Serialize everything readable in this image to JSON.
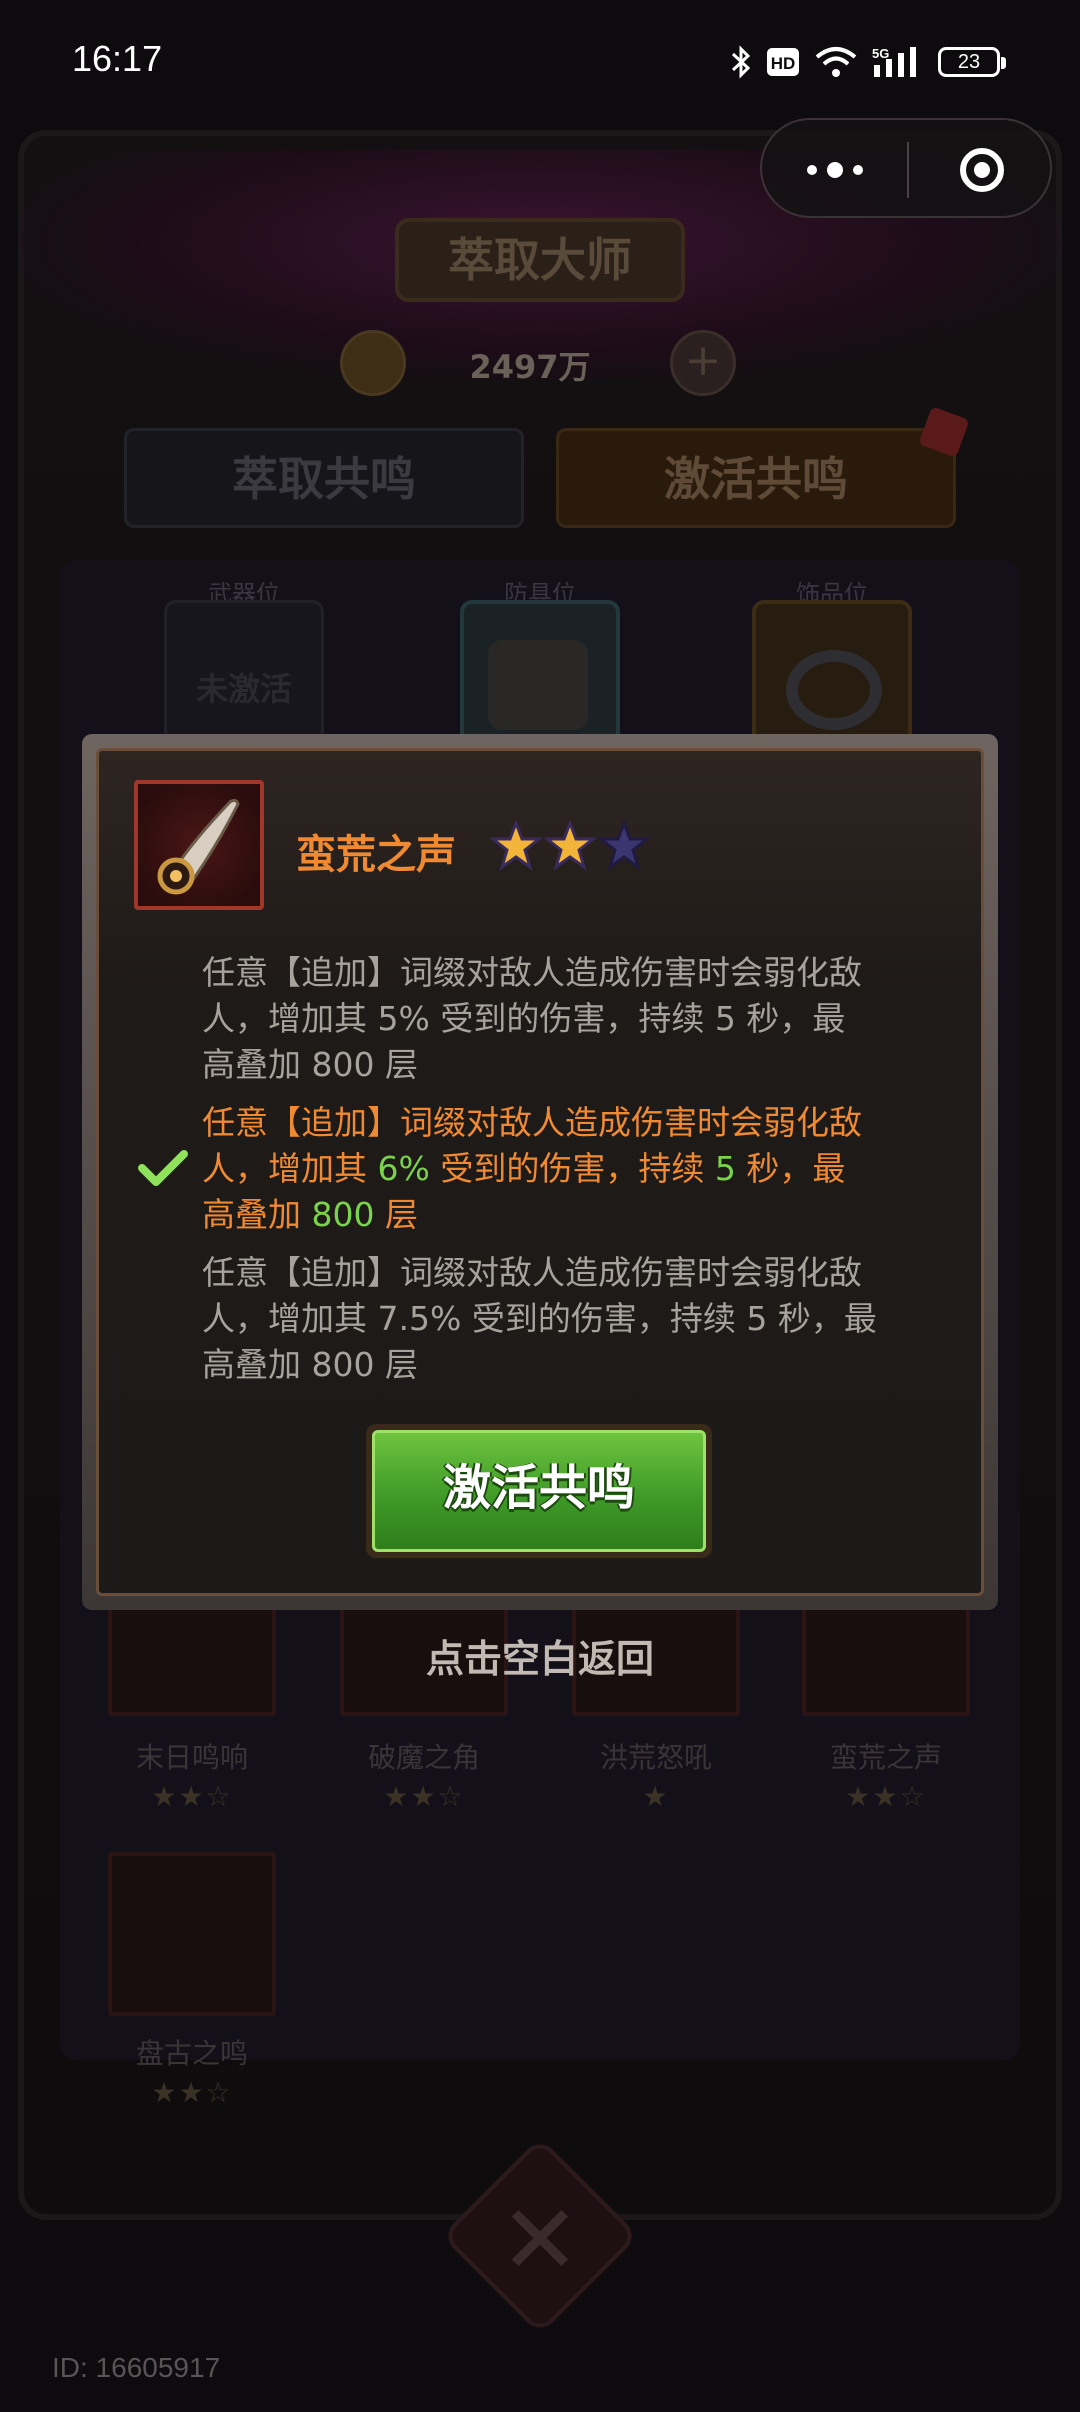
{
  "status_bar": {
    "time": "16:17",
    "battery": "23",
    "icons": [
      "bluetooth-icon",
      "hd-icon",
      "wifi-icon",
      "5g-signal-icon",
      "battery-icon"
    ]
  },
  "mini_program": {
    "more_icon": "more-dots-icon",
    "close_icon": "target-close-icon"
  },
  "background_screen": {
    "title": "萃取大师",
    "gold": "2497万",
    "tabs": [
      "萃取共鸣",
      "激活共鸣"
    ],
    "slots": [
      {
        "label": "武器位",
        "state": "未激活"
      },
      {
        "label": "防具位"
      },
      {
        "label": "饰品位"
      }
    ],
    "horns": [
      {
        "name": "末日鸣响",
        "stars": 2,
        "max_stars": 3
      },
      {
        "name": "破魔之角",
        "stars": 2,
        "max_stars": 3
      },
      {
        "name": "洪荒怒吼",
        "stars": 1,
        "max_stars": 1
      },
      {
        "name": "蛮荒之声",
        "stars": 2,
        "max_stars": 3
      },
      {
        "name": "盘古之鸣",
        "stars": 2,
        "max_stars": 3
      }
    ]
  },
  "modal": {
    "item_name": "蛮荒之声",
    "stars_filled": 2,
    "stars_total": 3,
    "effects": [
      {
        "selected": false,
        "line1": "任意【追加】词缀对敌人造成伤害时会弱化敌",
        "line2_pre": "人，增加其 ",
        "value": "5%",
        "line2_mid": " 受到的伤害，持续 ",
        "duration": "5",
        "line2_post": " 秒，最",
        "line3_pre": "高叠加 ",
        "stack": "800",
        "line3_post": " 层"
      },
      {
        "selected": true,
        "line1": "任意【追加】词缀对敌人造成伤害时会弱化敌",
        "line2_pre": "人，增加其 ",
        "value": "6%",
        "line2_mid": " 受到的伤害，持续 ",
        "duration": "5",
        "line2_post": " 秒，最",
        "line3_pre": "高叠加 ",
        "stack": "800",
        "line3_post": " 层"
      },
      {
        "selected": false,
        "line1": "任意【追加】词缀对敌人造成伤害时会弱化敌",
        "line2_pre": "人，增加其 ",
        "value": "7.5%",
        "line2_mid": " 受到的伤害，持续 ",
        "duration": "5",
        "line2_post": " 秒，最",
        "line3_pre": "高叠加 ",
        "stack": "800",
        "line3_post": " 层"
      }
    ],
    "activate_button": "激活共鸣",
    "dismiss_hint": "点击空白返回"
  },
  "footer": {
    "user_id": "ID: 16605917"
  },
  "colors": {
    "accent_orange": "#f08a32",
    "highlight_green": "#7ad34a",
    "button_green": "#3f9a28",
    "star_gold": "#f2b53a"
  }
}
